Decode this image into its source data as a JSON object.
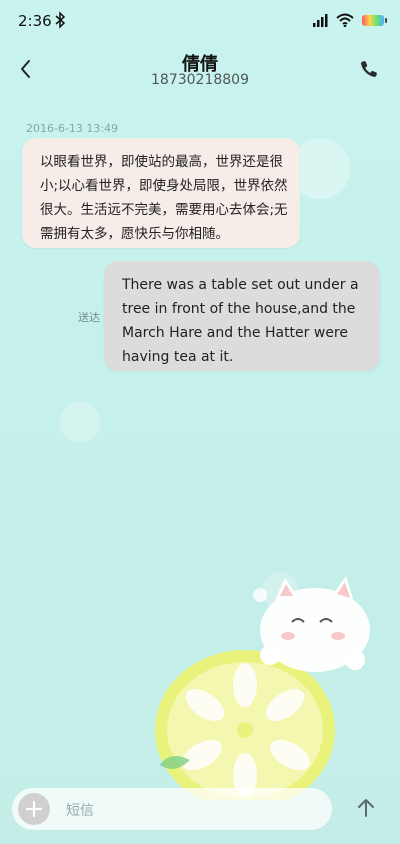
{
  "status_bar": {
    "time": "2:36"
  },
  "header": {
    "contact_name": "倩倩",
    "contact_number": "18730218809"
  },
  "messages": [
    {
      "type": "incoming",
      "timestamp": "2016-6-13 13:49",
      "text": "以眼看世界，即使站的最高，世界还是很小;以心看世界，即使身处局限，世界依然很大。生活远不完美，需要用心去体会;无需拥有太多，愿快乐与你相随。"
    },
    {
      "type": "outgoing",
      "status": "送达",
      "text": "There was a table set out under a tree in front of the house,and the March Hare and the Hatter were having tea at it."
    }
  ],
  "composer": {
    "placeholder": "短信"
  },
  "icons": {
    "back": "back-arrow-icon",
    "call": "phone-icon",
    "add": "plus-icon",
    "send": "send-arrow-up-icon",
    "bluetooth": "bluetooth-icon",
    "signal": "signal-icon",
    "wifi": "wifi-icon",
    "battery": "battery-icon"
  }
}
